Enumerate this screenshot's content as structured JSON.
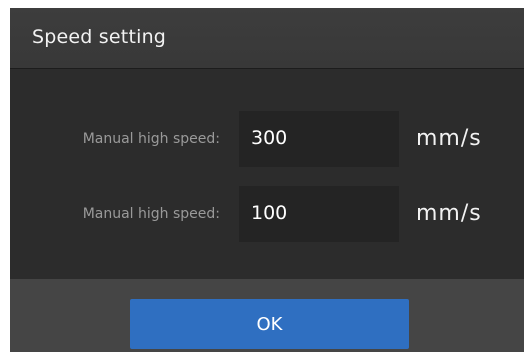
{
  "dialog": {
    "title": "Speed setting",
    "rows": [
      {
        "label": "Manual high speed:",
        "value": "300",
        "unit": "mm/s"
      },
      {
        "label": "Manual high speed:",
        "value": "100",
        "unit": "mm/s"
      }
    ],
    "ok_label": "OK"
  },
  "colors": {
    "background": "#2c2c2c",
    "title_bar": "#3a3a3a",
    "footer": "#454545",
    "value_box": "#242424",
    "ok_button": "#2f6fc1"
  }
}
